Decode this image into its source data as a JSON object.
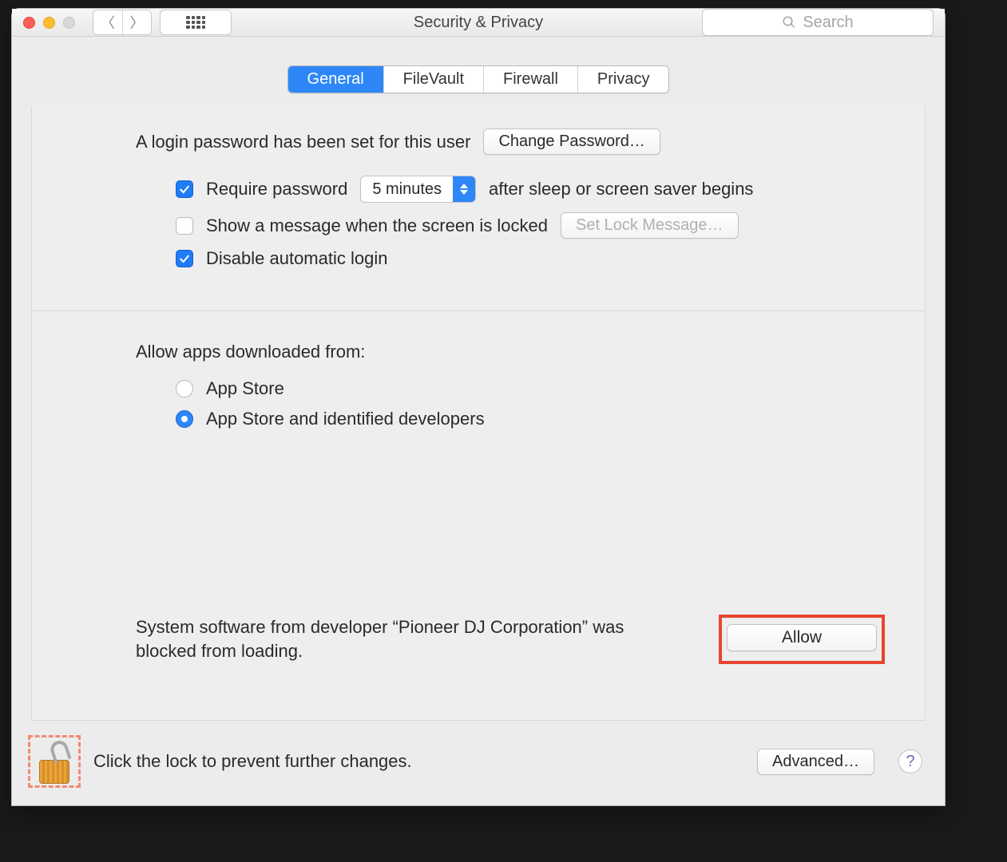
{
  "window": {
    "title": "Security & Privacy"
  },
  "search": {
    "placeholder": "Search"
  },
  "tabs": [
    "General",
    "FileVault",
    "Firewall",
    "Privacy"
  ],
  "selected_tab": "General",
  "login": {
    "password_set_label": "A login password has been set for this user",
    "change_password_button": "Change Password…",
    "require_password_label": "Require password",
    "require_password_checked": true,
    "delay_selected": "5 minutes",
    "delay_suffix": "after sleep or screen saver begins",
    "show_message_label": "Show a message when the screen is locked",
    "show_message_checked": false,
    "set_lock_message_button": "Set Lock Message…",
    "disable_auto_login_label": "Disable automatic login",
    "disable_auto_login_checked": true
  },
  "download": {
    "section_label": "Allow apps downloaded from:",
    "options": [
      "App Store",
      "App Store and identified developers"
    ],
    "selected_index": 1
  },
  "blocked": {
    "message": "System software from developer “Pioneer DJ Corporation” was blocked from loading.",
    "allow_button": "Allow"
  },
  "footer": {
    "lock_text": "Click the lock to prevent further changes.",
    "advanced_button": "Advanced…"
  }
}
